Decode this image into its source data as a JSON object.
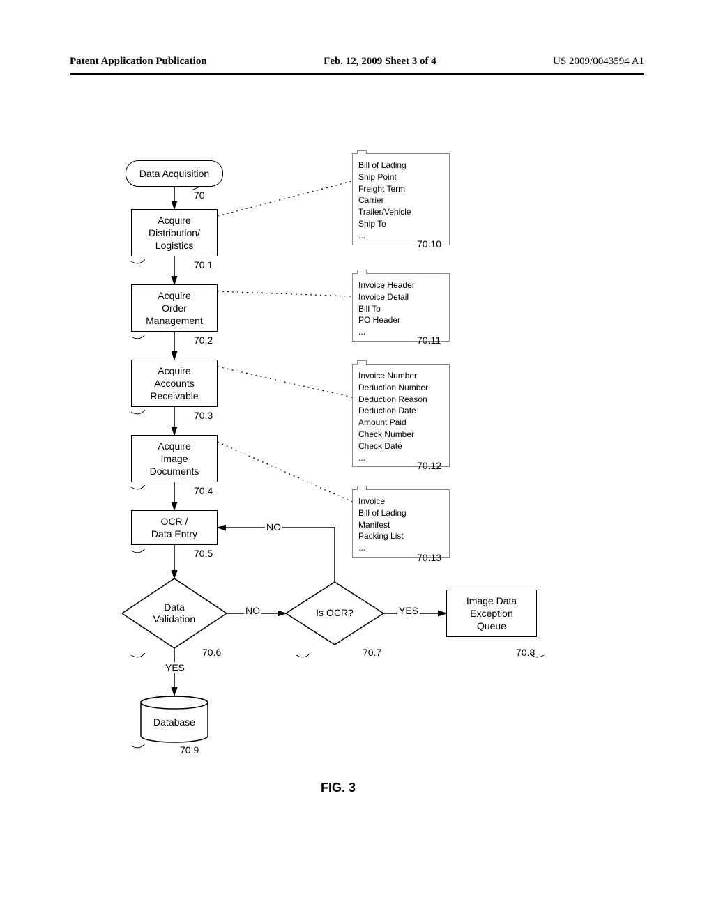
{
  "header": {
    "left": "Patent Application Publication",
    "center": "Feb. 12, 2009  Sheet 3 of 4",
    "right": "US 2009/0043594 A1"
  },
  "figure_label": "FIG. 3",
  "nodes": {
    "start": {
      "label": "Data Acquisition",
      "ref": "70"
    },
    "n1": {
      "label": "Acquire\nDistribution/\nLogistics",
      "ref": "70.1"
    },
    "n2": {
      "label": "Acquire\nOrder\nManagement",
      "ref": "70.2"
    },
    "n3": {
      "label": "Acquire\nAccounts\nReceivable",
      "ref": "70.3"
    },
    "n4": {
      "label": "Acquire\nImage\nDocuments",
      "ref": "70.4"
    },
    "n5": {
      "label": "OCR /\nData Entry",
      "ref": "70.5"
    },
    "d1": {
      "label": "Data\nValidation",
      "ref": "70.6"
    },
    "d2": {
      "label": "Is OCR?",
      "ref": "70.7"
    },
    "n8": {
      "label": "Image Data\nException\nQueue",
      "ref": "70.8"
    },
    "db": {
      "label": "Database",
      "ref": "70.9"
    }
  },
  "side": {
    "s10": {
      "ref": "70.10",
      "lines": "Bill of Lading\nShip Point\nFreight Term\nCarrier\nTrailer/Vehicle\nShip To\n..."
    },
    "s11": {
      "ref": "70.11",
      "lines": "Invoice Header\nInvoice Detail\nBill To\nPO Header\n..."
    },
    "s12": {
      "ref": "70.12",
      "lines": "Invoice Number\nDeduction Number\nDeduction Reason\nDeduction Date\nAmount Paid\nCheck Number\nCheck Date\n..."
    },
    "s13": {
      "ref": "70.13",
      "lines": "Invoice\nBill of Lading\nManifest\nPacking List\n..."
    }
  },
  "edge_labels": {
    "no1": "NO",
    "no2": "NO",
    "yes1": "YES",
    "yes2": "YES"
  },
  "chart_data": {
    "type": "flowchart",
    "title": "FIG. 3 — Data Acquisition",
    "nodes": [
      {
        "id": "70",
        "type": "terminator",
        "label": "Data Acquisition"
      },
      {
        "id": "70.1",
        "type": "process",
        "label": "Acquire Distribution/Logistics"
      },
      {
        "id": "70.2",
        "type": "process",
        "label": "Acquire Order Management"
      },
      {
        "id": "70.3",
        "type": "process",
        "label": "Acquire Accounts Receivable"
      },
      {
        "id": "70.4",
        "type": "process",
        "label": "Acquire Image Documents"
      },
      {
        "id": "70.5",
        "type": "process",
        "label": "OCR / Data Entry"
      },
      {
        "id": "70.6",
        "type": "decision",
        "label": "Data Validation"
      },
      {
        "id": "70.7",
        "type": "decision",
        "label": "Is OCR?"
      },
      {
        "id": "70.8",
        "type": "process",
        "label": "Image Data Exception Queue"
      },
      {
        "id": "70.9",
        "type": "datastore",
        "label": "Database"
      },
      {
        "id": "70.10",
        "type": "data",
        "label": "Bill of Lading; Ship Point; Freight Term; Carrier; Trailer/Vehicle; Ship To; ..."
      },
      {
        "id": "70.11",
        "type": "data",
        "label": "Invoice Header; Invoice Detail; Bill To; PO Header; ..."
      },
      {
        "id": "70.12",
        "type": "data",
        "label": "Invoice Number; Deduction Number; Deduction Reason; Deduction Date; Amount Paid; Check Number; Check Date; ..."
      },
      {
        "id": "70.13",
        "type": "data",
        "label": "Invoice; Bill of Lading; Manifest; Packing List; ..."
      }
    ],
    "edges": [
      {
        "from": "70",
        "to": "70.1"
      },
      {
        "from": "70.1",
        "to": "70.2"
      },
      {
        "from": "70.2",
        "to": "70.3"
      },
      {
        "from": "70.3",
        "to": "70.4"
      },
      {
        "from": "70.4",
        "to": "70.5"
      },
      {
        "from": "70.5",
        "to": "70.6"
      },
      {
        "from": "70.6",
        "to": "70.7",
        "label": "NO"
      },
      {
        "from": "70.6",
        "to": "70.9",
        "label": "YES"
      },
      {
        "from": "70.7",
        "to": "70.5",
        "label": "NO"
      },
      {
        "from": "70.7",
        "to": "70.8",
        "label": "YES"
      },
      {
        "from": "70.1",
        "to": "70.10",
        "style": "dotted"
      },
      {
        "from": "70.2",
        "to": "70.11",
        "style": "dotted"
      },
      {
        "from": "70.3",
        "to": "70.12",
        "style": "dotted"
      },
      {
        "from": "70.4",
        "to": "70.13",
        "style": "dotted"
      }
    ]
  }
}
